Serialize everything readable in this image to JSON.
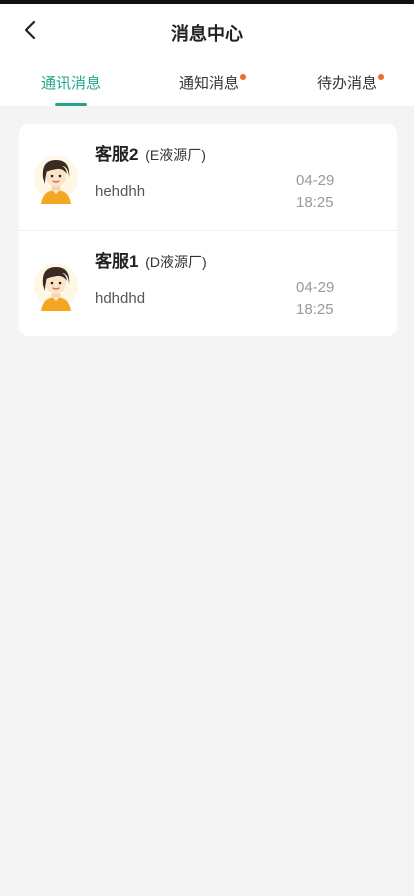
{
  "header": {
    "title": "消息中心"
  },
  "tabs": [
    {
      "label": "通讯消息",
      "active": true,
      "badge": false
    },
    {
      "label": "通知消息",
      "active": false,
      "badge": true
    },
    {
      "label": "待办消息",
      "active": false,
      "badge": true
    }
  ],
  "messages": [
    {
      "name": "客服2",
      "company": "(E液源厂)",
      "preview": "hehdhh",
      "date": "04-29",
      "time": "18:25",
      "avatar_icon": "female-avatar-icon"
    },
    {
      "name": "客服1",
      "company": "(D液源厂)",
      "preview": "hdhdhd",
      "date": "04-29",
      "time": "18:25",
      "avatar_icon": "female-avatar-icon"
    }
  ],
  "colors": {
    "accent": "#23a58a",
    "badge": "#f26b21",
    "background": "#f4f4f4"
  }
}
